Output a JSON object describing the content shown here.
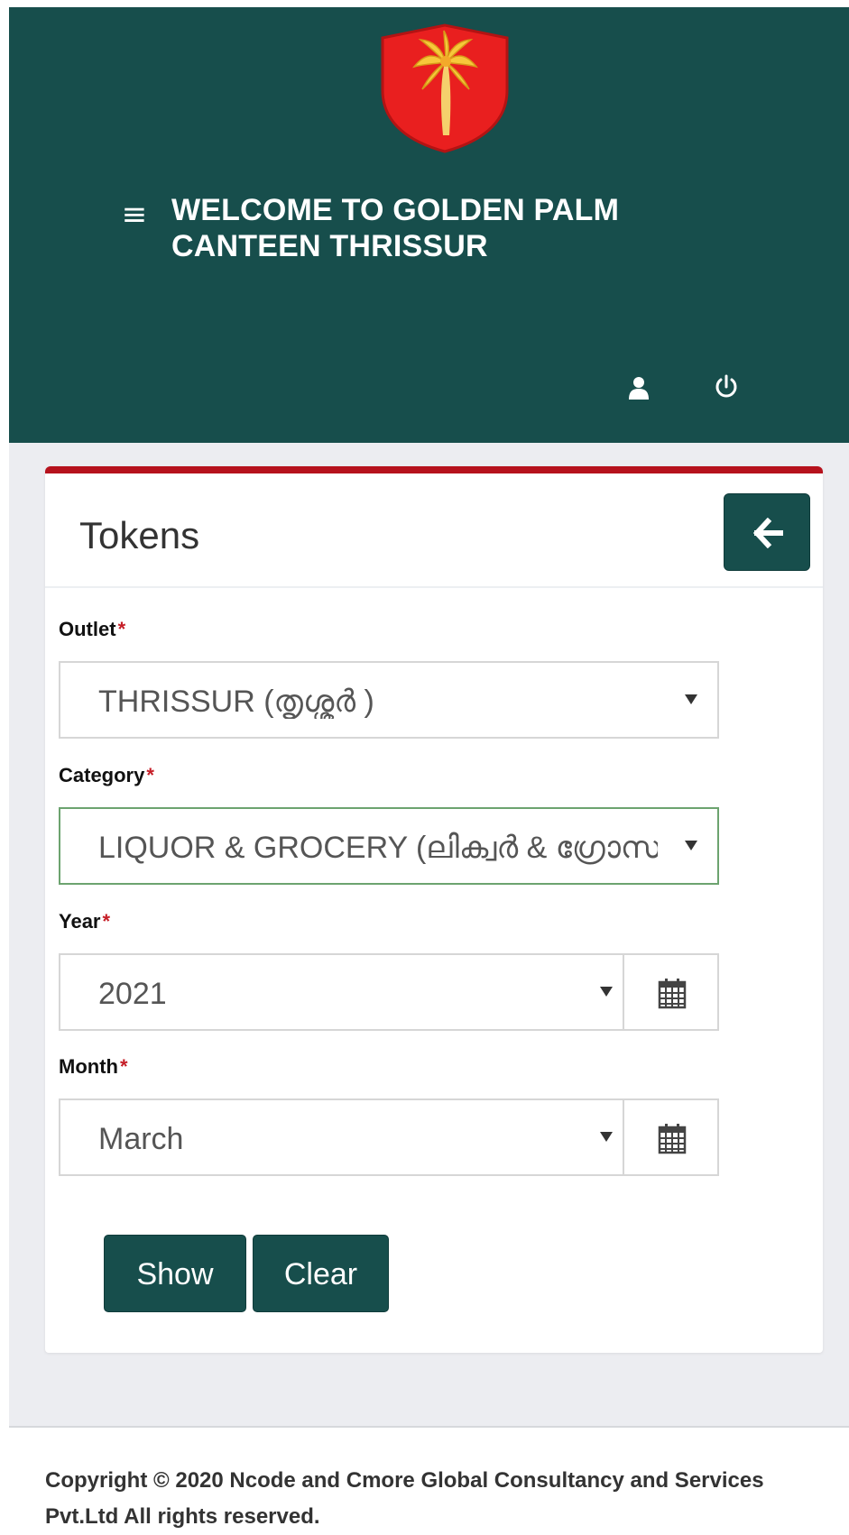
{
  "header": {
    "title": "WELCOME TO GOLDEN PALM CANTEEN THRISSUR",
    "menu_icon": "hamburger-menu-icon",
    "logo_icon": "golden-palm-shield-logo",
    "user_icon": "user-icon",
    "power_icon": "power-icon",
    "background_color": "#174e4c"
  },
  "page": {
    "title": "Tokens",
    "accent_color": "#b6121d",
    "back_icon": "arrow-left-icon"
  },
  "form": {
    "outlet": {
      "label": "Outlet",
      "required_mark": "*",
      "selected_value": "THRISSUR (തൃശ്ശൂർ )"
    },
    "category": {
      "label": "Category",
      "required_mark": "*",
      "selected_value": "LIQUOR & GROCERY (ലിക്വർ & ഗ്രോസ"
    },
    "year": {
      "label": "Year",
      "required_mark": "*",
      "selected_value": "2021"
    },
    "month": {
      "label": "Month",
      "required_mark": "*",
      "selected_value": "March"
    }
  },
  "actions": {
    "show_label": "Show",
    "clear_label": "Clear"
  },
  "footer": {
    "copyright": "Copyright © 2020 Ncode and Cmore Global Consultancy and Services Pvt.Ltd  All rights reserved."
  }
}
